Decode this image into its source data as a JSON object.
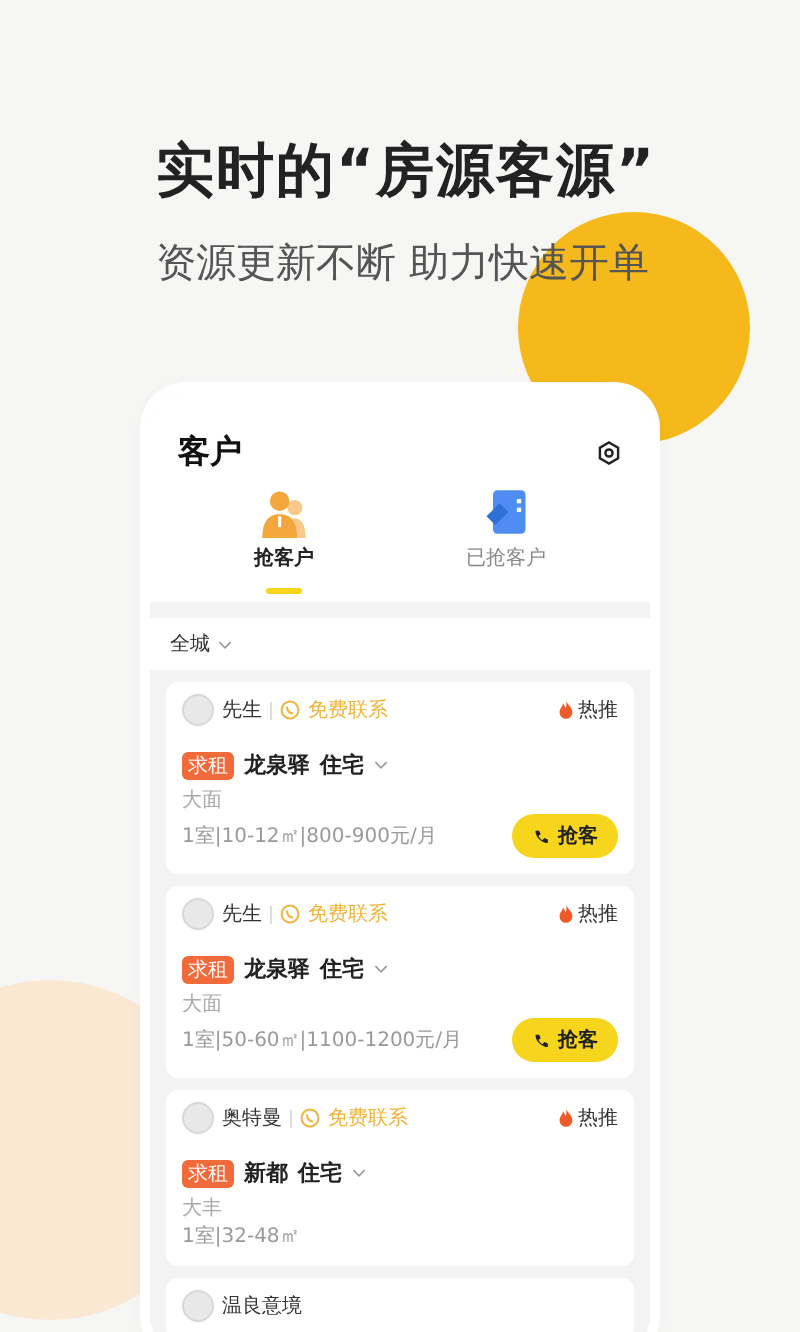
{
  "headline": "实时的“房源客源”",
  "subline": "资源更新不断 助力快速开单",
  "screen": {
    "title": "客户",
    "tabs": [
      {
        "label": "抢客户",
        "kind": "person",
        "selected": true
      },
      {
        "label": "已抢客户",
        "kind": "tag",
        "selected": false
      }
    ],
    "filter": "全城",
    "cards": [
      {
        "name": "先生",
        "contact": "免费联系",
        "hot": "热推",
        "tag": "求租",
        "place": "龙泉驿",
        "type": "住宅",
        "area": "大面",
        "specs": "1室|10-12㎡|800-900元/月",
        "action": "抢客"
      },
      {
        "name": "先生",
        "contact": "免费联系",
        "hot": "热推",
        "tag": "求租",
        "place": "龙泉驿",
        "type": "住宅",
        "area": "大面",
        "specs": "1室|50-60㎡|1100-1200元/月",
        "action": "抢客"
      },
      {
        "name": "奥特曼",
        "contact": "免费联系",
        "hot": "热推",
        "tag": "求租",
        "place": "新都",
        "type": "住宅",
        "area": "大丰",
        "specs": "1室|32-48㎡"
      },
      {
        "name": "温良意境"
      }
    ]
  }
}
